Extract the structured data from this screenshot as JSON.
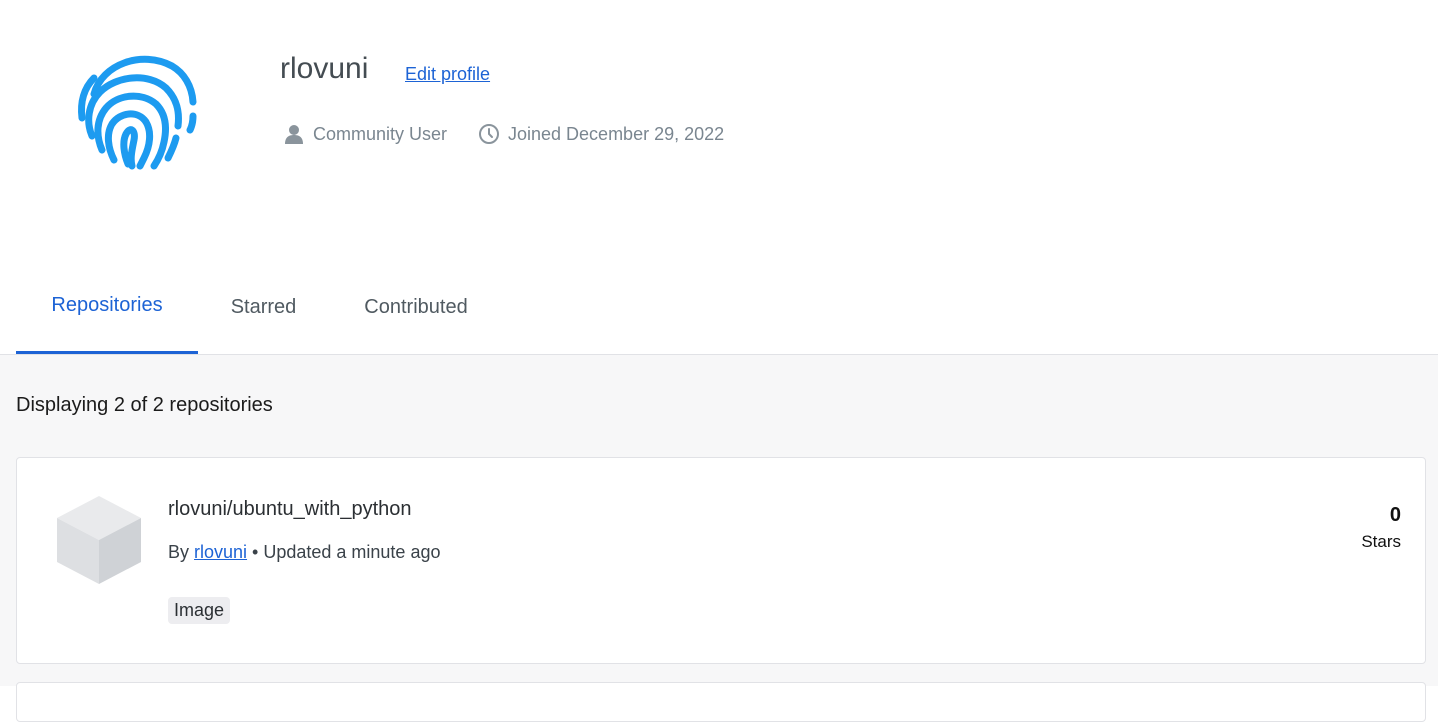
{
  "profile": {
    "username": "rlovuni",
    "edit_label": "Edit profile",
    "role": "Community User",
    "joined": "Joined December 29, 2022",
    "avatar_icon": "fingerprint-icon",
    "accent_color": "#1d9bf0"
  },
  "tabs": [
    {
      "label": "Repositories",
      "active": true
    },
    {
      "label": "Starred",
      "active": false
    },
    {
      "label": "Contributed",
      "active": false
    }
  ],
  "repos_summary": "Displaying 2 of 2 repositories",
  "repositories": [
    {
      "name": "rlovuni/ubuntu_with_python",
      "by_prefix": "By ",
      "owner": "rlovuni",
      "updated": " • Updated a minute ago",
      "badge": "Image",
      "stars": "0",
      "stars_label": "Stars",
      "icon": "cube-icon"
    }
  ],
  "colors": {
    "link": "#1d63d5",
    "active_tab": "#1d63d5",
    "content_bg": "#f7f7f8"
  }
}
